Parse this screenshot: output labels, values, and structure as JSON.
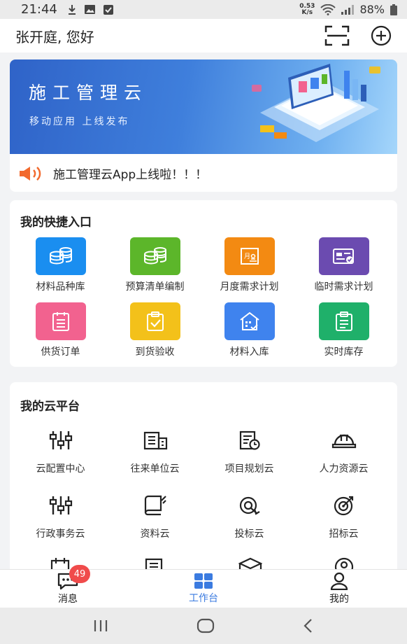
{
  "status": {
    "time": "21:44",
    "net_speed_value": "0.53",
    "net_speed_unit": "K/s",
    "battery": "88%"
  },
  "header": {
    "greeting": "张开庭, 您好",
    "icons": [
      "scan-icon",
      "add-circle-icon"
    ]
  },
  "banner": {
    "title": "施工管理云",
    "subtitle": "移动应用  上线发布"
  },
  "notice": {
    "text": "施工管理云App上线啦！！！",
    "icon": "speaker-icon"
  },
  "quick": {
    "title": "我的快捷入口",
    "items": [
      {
        "label": "材料品种库",
        "color": "#1a8ef0",
        "icon": "coins-icon"
      },
      {
        "label": "预算清单编制",
        "color": "#5cb62a",
        "icon": "coins-icon"
      },
      {
        "label": "月度需求计划",
        "color": "#f38a12",
        "icon": "monthly-plan-icon"
      },
      {
        "label": "临时需求计划",
        "color": "#6b4bb0",
        "icon": "temp-plan-icon"
      },
      {
        "label": "供货订单",
        "color": "#f2628f",
        "icon": "order-list-icon"
      },
      {
        "label": "到货验收",
        "color": "#f3c11a",
        "icon": "check-clipboard-icon"
      },
      {
        "label": "材料入库",
        "color": "#3f83ee",
        "icon": "warehouse-icon"
      },
      {
        "label": "实时库存",
        "color": "#1fb06a",
        "icon": "inventory-icon"
      }
    ]
  },
  "cloud": {
    "title": "我的云平台",
    "items": [
      {
        "label": "云配置中心",
        "icon": "sliders-icon"
      },
      {
        "label": "往来单位云",
        "icon": "building-icon"
      },
      {
        "label": "项目规划云",
        "icon": "project-clock-icon"
      },
      {
        "label": "人力资源云",
        "icon": "helmet-icon"
      },
      {
        "label": "行政事务云",
        "icon": "sliders-icon"
      },
      {
        "label": "资料云",
        "icon": "book-icon"
      },
      {
        "label": "投标云",
        "icon": "bid-icon"
      },
      {
        "label": "招标云",
        "icon": "target-icon"
      }
    ]
  },
  "tabs": [
    {
      "label": "消息",
      "icon": "message-icon",
      "badge": "49"
    },
    {
      "label": "工作台",
      "icon": "grid-icon",
      "active": true
    },
    {
      "label": "我的",
      "icon": "person-icon"
    }
  ],
  "colors": {
    "accent": "#3b7be0",
    "badge": "#f04b4b"
  }
}
